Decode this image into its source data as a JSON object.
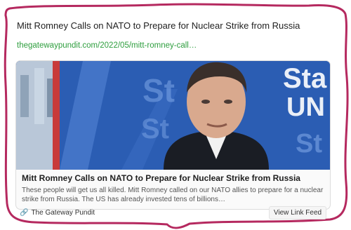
{
  "post": {
    "title": "Mitt Romney Calls on NATO to Prepare for Nuclear Strike from Russia",
    "link": "thegatewaypundit.com/2022/05/mitt-romney-call…"
  },
  "card": {
    "title": "Mitt Romney Calls on NATO to Prepare for Nuclear Strike from Russia",
    "description": "These people will get us all killed. Mitt Romney called on our NATO allies to prepare for a nuclear strike from Russia. The US has already invested tens of billions…",
    "thumb_text": [
      "Sta",
      "UN"
    ]
  },
  "footer": {
    "source": "The Gateway Pundit",
    "source_icon": "link-icon",
    "view_button": "View Link Feed"
  },
  "colors": {
    "outline": "#b5295f",
    "link": "#2e9e3e",
    "thumb_bg": "#2b5db3"
  }
}
